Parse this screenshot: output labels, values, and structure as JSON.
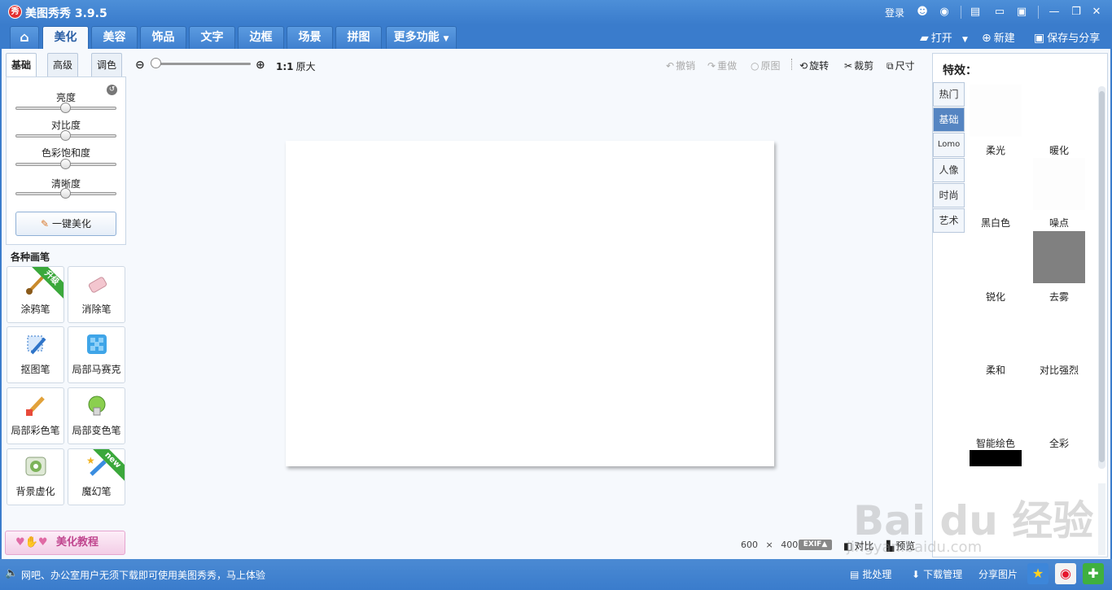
{
  "app": {
    "logo": "秀",
    "title": "美图秀秀 3.9.5"
  },
  "titlebar": {
    "login": "登录",
    "icons": [
      "qq-icon",
      "weibo-icon",
      "skin-icon",
      "message-icon",
      "feedback-icon",
      "minimize-icon",
      "restore-icon",
      "close-icon"
    ]
  },
  "tabs": {
    "home": "⌂",
    "items": [
      "美化",
      "美容",
      "饰品",
      "文字",
      "边框",
      "场景",
      "拼图",
      "更多功能"
    ],
    "active": "美化"
  },
  "right_actions": {
    "open": "打开",
    "new": "新建",
    "save_share": "保存与分享"
  },
  "left_panel": {
    "sub_tabs": [
      "基础",
      "高级",
      "调色"
    ],
    "sliders": [
      "亮度",
      "对比度",
      "色彩饱和度",
      "清晰度"
    ],
    "one_click": "一键美化",
    "brushes_title": "各种画笔",
    "brushes": [
      {
        "label": "涂鸦笔",
        "badge": "升级"
      },
      {
        "label": "消除笔"
      },
      {
        "label": "抠图笔"
      },
      {
        "label": "局部马赛克"
      },
      {
        "label": "局部彩色笔"
      },
      {
        "label": "局部变色笔"
      },
      {
        "label": "背景虚化"
      },
      {
        "label": "魔幻笔",
        "badge": "new"
      }
    ],
    "tutorial": "美化教程"
  },
  "toolbar": {
    "actual_size_ratio": "1:1",
    "actual_size": "原大",
    "undo": "撤销",
    "redo": "重做",
    "original": "原图",
    "rotate": "旋转",
    "crop": "裁剪",
    "resize": "尺寸"
  },
  "canvas": {
    "width": "600",
    "times": "×",
    "height": "400",
    "exif": "EXIF▲",
    "compare": "对比",
    "preview": "预览"
  },
  "effects": {
    "title": "特效：",
    "categories": [
      "热门",
      "基础",
      "Lomo",
      "人像",
      "时尚",
      "艺术"
    ],
    "active_category": "基础",
    "items": [
      "柔光",
      "暖化",
      "黑白色",
      "噪点",
      "锐化",
      "去雾",
      "柔和",
      "对比强烈",
      "智能绘色",
      "全彩"
    ]
  },
  "statusbar": {
    "message": "网吧、办公室用户无须下载即可使用美图秀秀，马上体验",
    "batch": "批处理",
    "download_manager": "下载管理",
    "share_image": "分享图片"
  },
  "watermark": {
    "brand": "Bai du 经验",
    "url": "jingyan.baidu.com"
  },
  "colors": {
    "accent": "#3a7ccc",
    "active_category": "#5585c2",
    "tutorial": "#c0468f"
  }
}
